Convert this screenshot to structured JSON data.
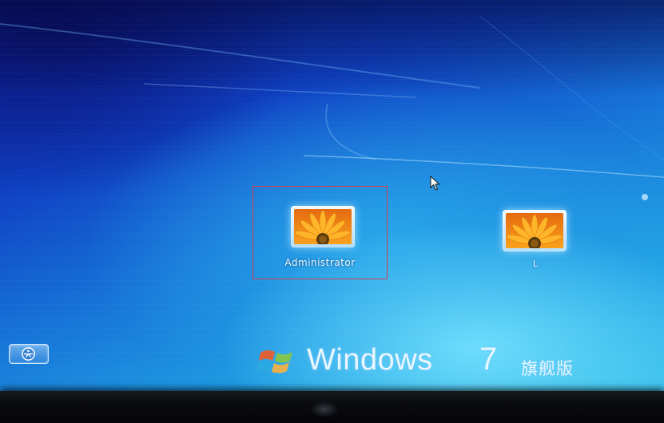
{
  "users": [
    {
      "name": "Administrator",
      "selected": true
    },
    {
      "name": "L",
      "selected": false
    }
  ],
  "branding": {
    "product": "Windows",
    "version": "7",
    "edition": "旗舰版"
  },
  "icons": {
    "ease_of_access": "ease-of-access-icon",
    "user_picture": "flower-user-picture",
    "cursor": "mouse-pointer-icon",
    "logo": "windows-flag-logo"
  },
  "colors": {
    "background_deep": "#0a1f9c",
    "background_light": "#33c0ec",
    "selection_border": "#d2414a"
  }
}
